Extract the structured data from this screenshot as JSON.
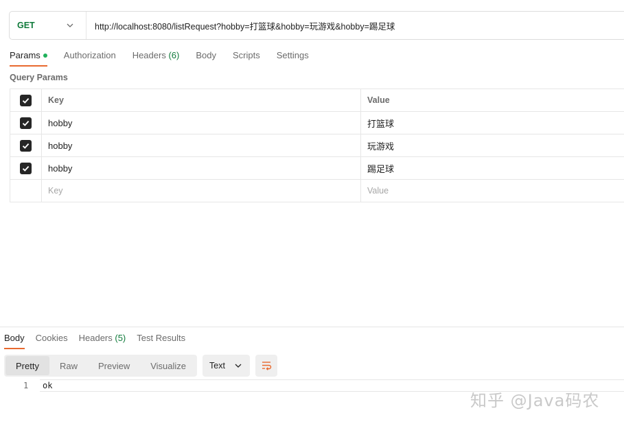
{
  "request": {
    "method": "GET",
    "url": "http://localhost:8080/listRequest?hobby=打篮球&hobby=玩游戏&hobby=踢足球"
  },
  "request_tabs": [
    {
      "label": "Params",
      "active": true,
      "dot": true
    },
    {
      "label": "Authorization"
    },
    {
      "label": "Headers",
      "count": "(6)"
    },
    {
      "label": "Body"
    },
    {
      "label": "Scripts"
    },
    {
      "label": "Settings"
    }
  ],
  "query_params": {
    "title": "Query Params",
    "header": {
      "key": "Key",
      "value": "Value"
    },
    "rows": [
      {
        "key": "hobby",
        "value": "打篮球",
        "checked": true
      },
      {
        "key": "hobby",
        "value": "玩游戏",
        "checked": true
      },
      {
        "key": "hobby",
        "value": "踢足球",
        "checked": true
      }
    ],
    "placeholder": {
      "key": "Key",
      "value": "Value"
    }
  },
  "response_tabs": [
    {
      "label": "Body",
      "active": true
    },
    {
      "label": "Cookies"
    },
    {
      "label": "Headers",
      "count": "(5)"
    },
    {
      "label": "Test Results"
    }
  ],
  "view_modes": [
    "Pretty",
    "Raw",
    "Preview",
    "Visualize"
  ],
  "format": "Text",
  "response_body": {
    "line_number": "1",
    "text": "ok"
  },
  "watermark": "知乎 @Java码农",
  "colors": {
    "accent": "#e8692e",
    "method_get": "#0f7a3a",
    "status_dot": "#1fb15b"
  },
  "icons": [
    "chevron-down-icon",
    "checkbox-checked-icon",
    "wrap-lines-icon"
  ]
}
